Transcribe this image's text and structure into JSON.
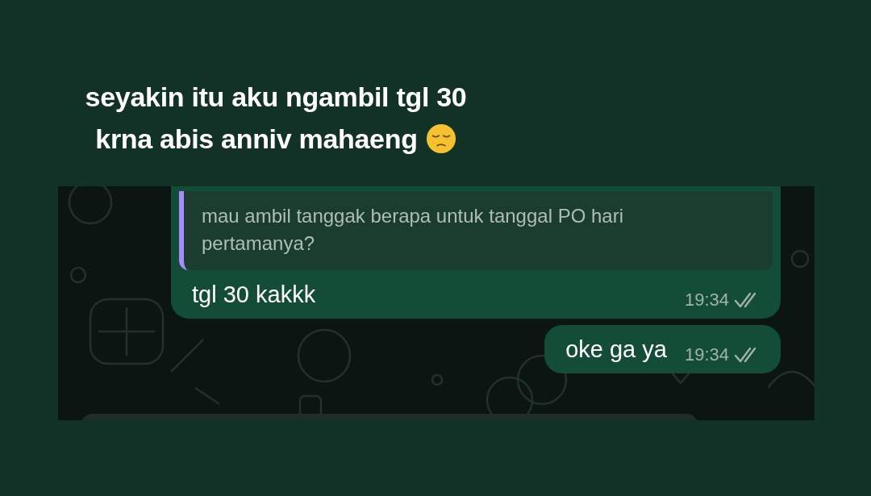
{
  "caption": {
    "lines": [
      "seyakin itu aku ngambil tgl 30",
      "krna abis anniv mahaeng"
    ]
  },
  "messages": [
    {
      "kind": "reply",
      "quote": "mau ambil tanggak berapa untuk tanggal PO hari pertamanya?",
      "text": "tgl 30 kakkk",
      "time": "19:34",
      "read": false
    },
    {
      "kind": "plain",
      "text": "oke ga ya",
      "time": "19:34",
      "read": false
    }
  ]
}
